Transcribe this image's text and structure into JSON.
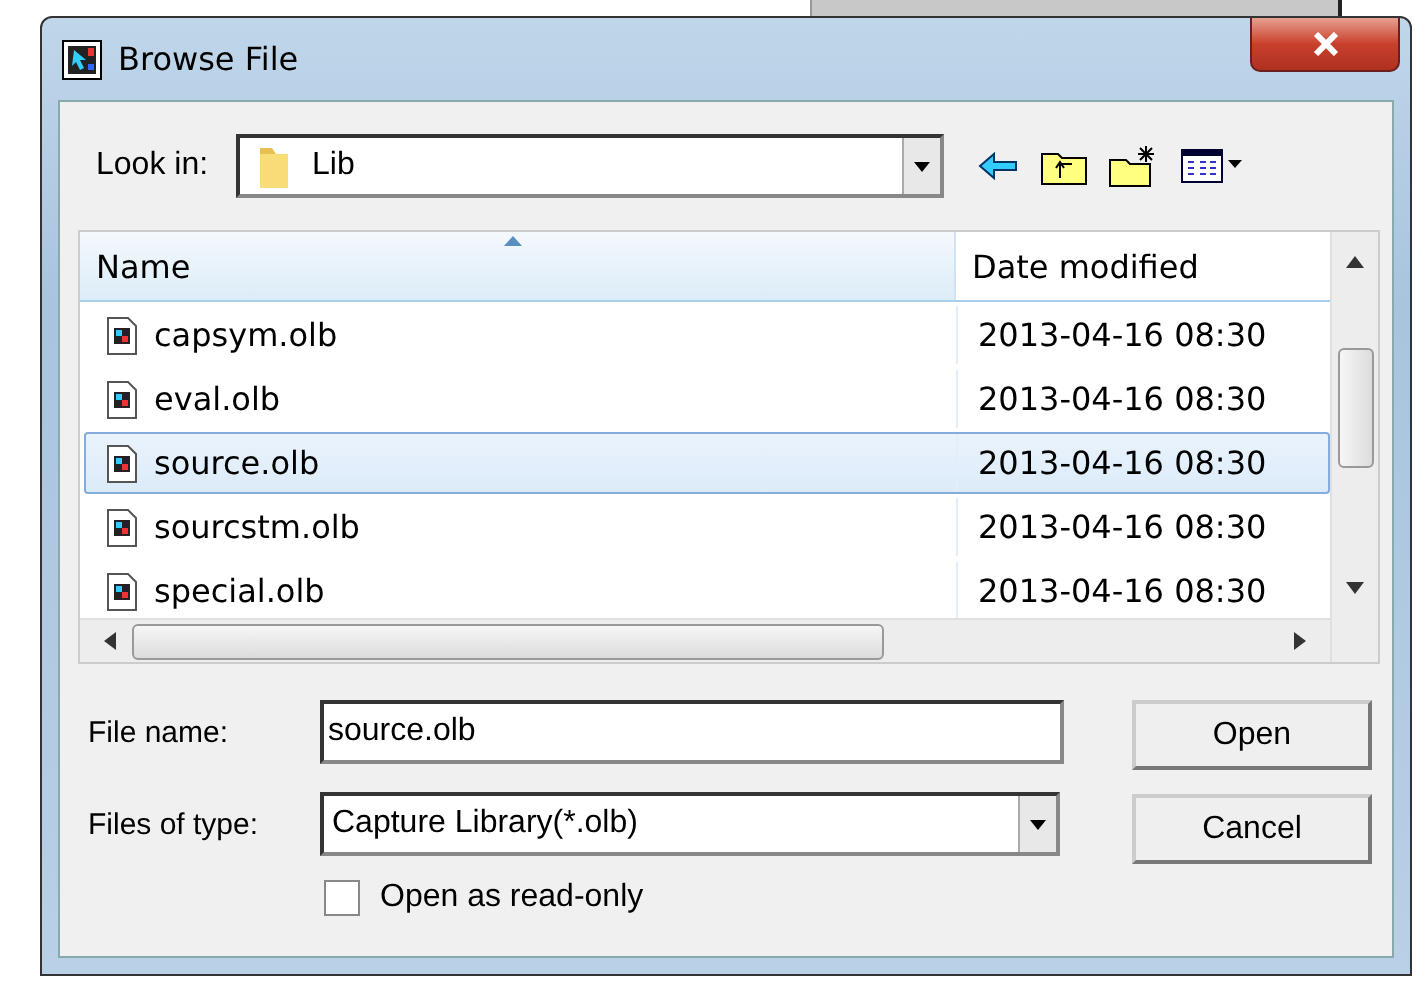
{
  "window": {
    "title": "Browse File"
  },
  "look_in": {
    "label": "Look in:",
    "value": "Lib"
  },
  "columns": [
    {
      "label": "Name",
      "sorted": true
    },
    {
      "label": "Date modified",
      "sorted": false
    }
  ],
  "files": [
    {
      "name": "capsym.olb",
      "date": "2013-04-16 08:30",
      "selected": false
    },
    {
      "name": "eval.olb",
      "date": "2013-04-16 08:30",
      "selected": false
    },
    {
      "name": "source.olb",
      "date": "2013-04-16 08:30",
      "selected": true
    },
    {
      "name": "sourcstm.olb",
      "date": "2013-04-16 08:30",
      "selected": false
    },
    {
      "name": "special.olb",
      "date": "2013-04-16 08:30",
      "selected": false
    }
  ],
  "file_name": {
    "label": "File name:",
    "value": "source.olb"
  },
  "file_type": {
    "label": "Files of type:",
    "value": "Capture Library(*.olb)"
  },
  "read_only": {
    "label": "Open as read-only",
    "checked": false
  },
  "buttons": [
    {
      "label": "Open"
    },
    {
      "label": "Cancel"
    }
  ]
}
